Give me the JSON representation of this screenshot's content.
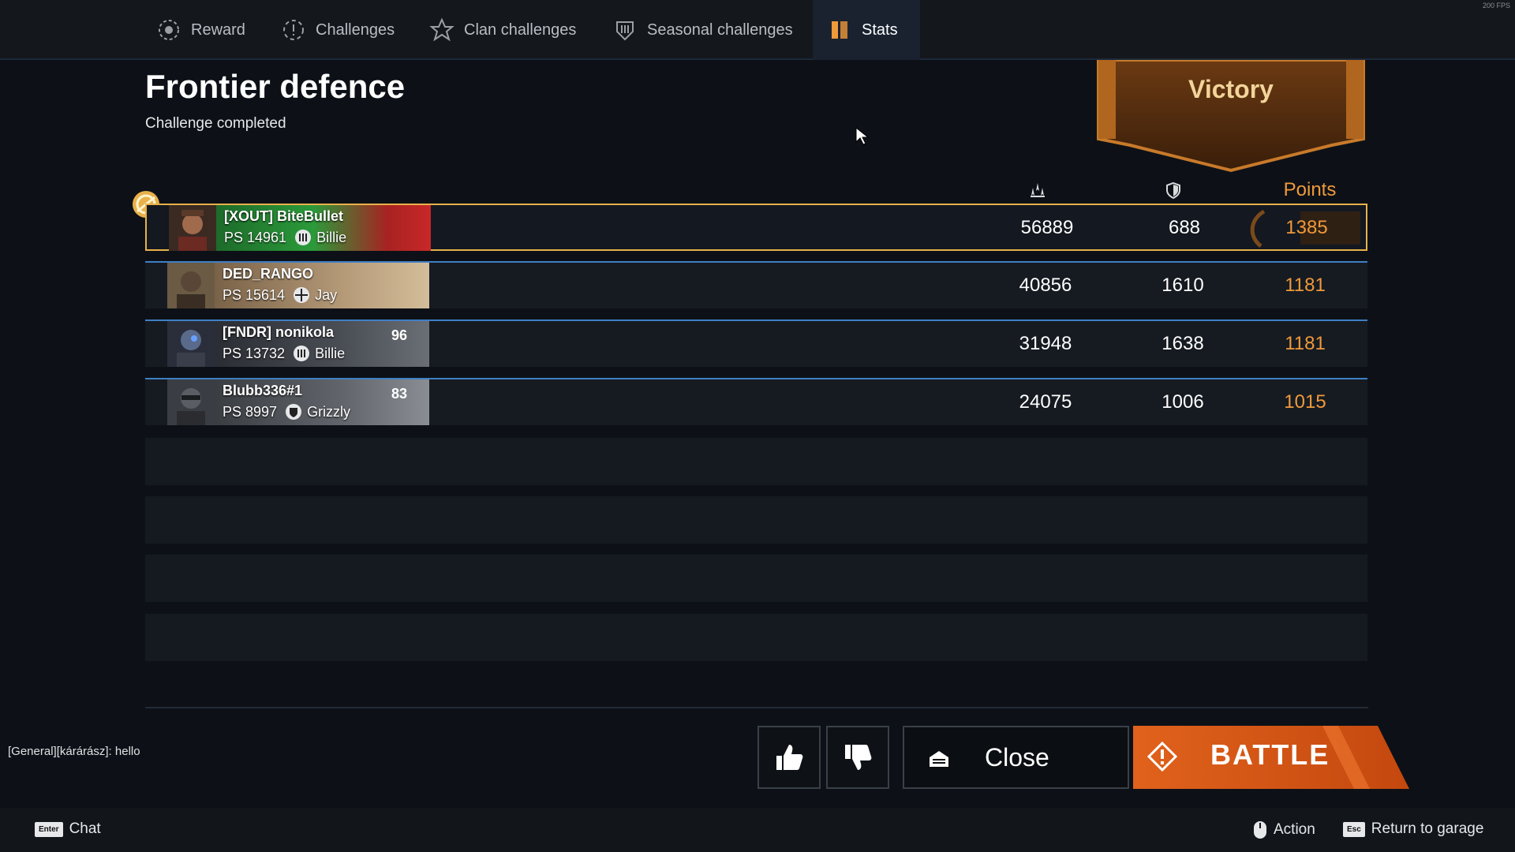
{
  "fps_text": "200 FPS",
  "tabs": [
    {
      "label": "Reward",
      "icon": "reward-icon"
    },
    {
      "label": "Challenges",
      "icon": "challenges-icon"
    },
    {
      "label": "Clan challenges",
      "icon": "clan-challenges-icon"
    },
    {
      "label": "Seasonal challenges",
      "icon": "seasonal-challenges-icon"
    },
    {
      "label": "Stats",
      "icon": "stats-icon",
      "active": true
    }
  ],
  "header": {
    "title": "Frontier defence",
    "subtitle": "Challenge completed",
    "result": "Victory"
  },
  "columns": {
    "damage_icon": "damage-icon",
    "defence_icon": "shield-icon",
    "points": "Points"
  },
  "players": [
    {
      "name": "[XOUT] BiteBullet",
      "ps": "PS 14961",
      "crew": "Billie",
      "level": "",
      "damage": "56889",
      "defence": "688",
      "points": "1385",
      "highlight": true
    },
    {
      "name": "DED_RANGO",
      "ps": "PS 15614",
      "crew": "Jay",
      "level": "",
      "damage": "40856",
      "defence": "1610",
      "points": "1181"
    },
    {
      "name": "[FNDR] nonikola",
      "ps": "PS 13732",
      "crew": "Billie",
      "level": "96",
      "damage": "31948",
      "defence": "1638",
      "points": "1181"
    },
    {
      "name": "Blubb336#1",
      "ps": "PS 8997",
      "crew": "Grizzly",
      "level": "83",
      "damage": "24075",
      "defence": "1006",
      "points": "1015"
    }
  ],
  "chat_message": "[General][kárárász]: hello",
  "buttons": {
    "like": "thumbs-up-icon",
    "dislike": "thumbs-down-icon",
    "close": "Close",
    "battle": "BATTLE"
  },
  "hints": {
    "chat_key": "Enter",
    "chat": "Chat",
    "action": "Action",
    "garage_key": "Esc",
    "garage": "Return to garage"
  },
  "colors": {
    "accent": "#f0993a",
    "highlight_border": "#e8b14a",
    "divider": "#3f7fc4",
    "battle": "#e0621c"
  }
}
